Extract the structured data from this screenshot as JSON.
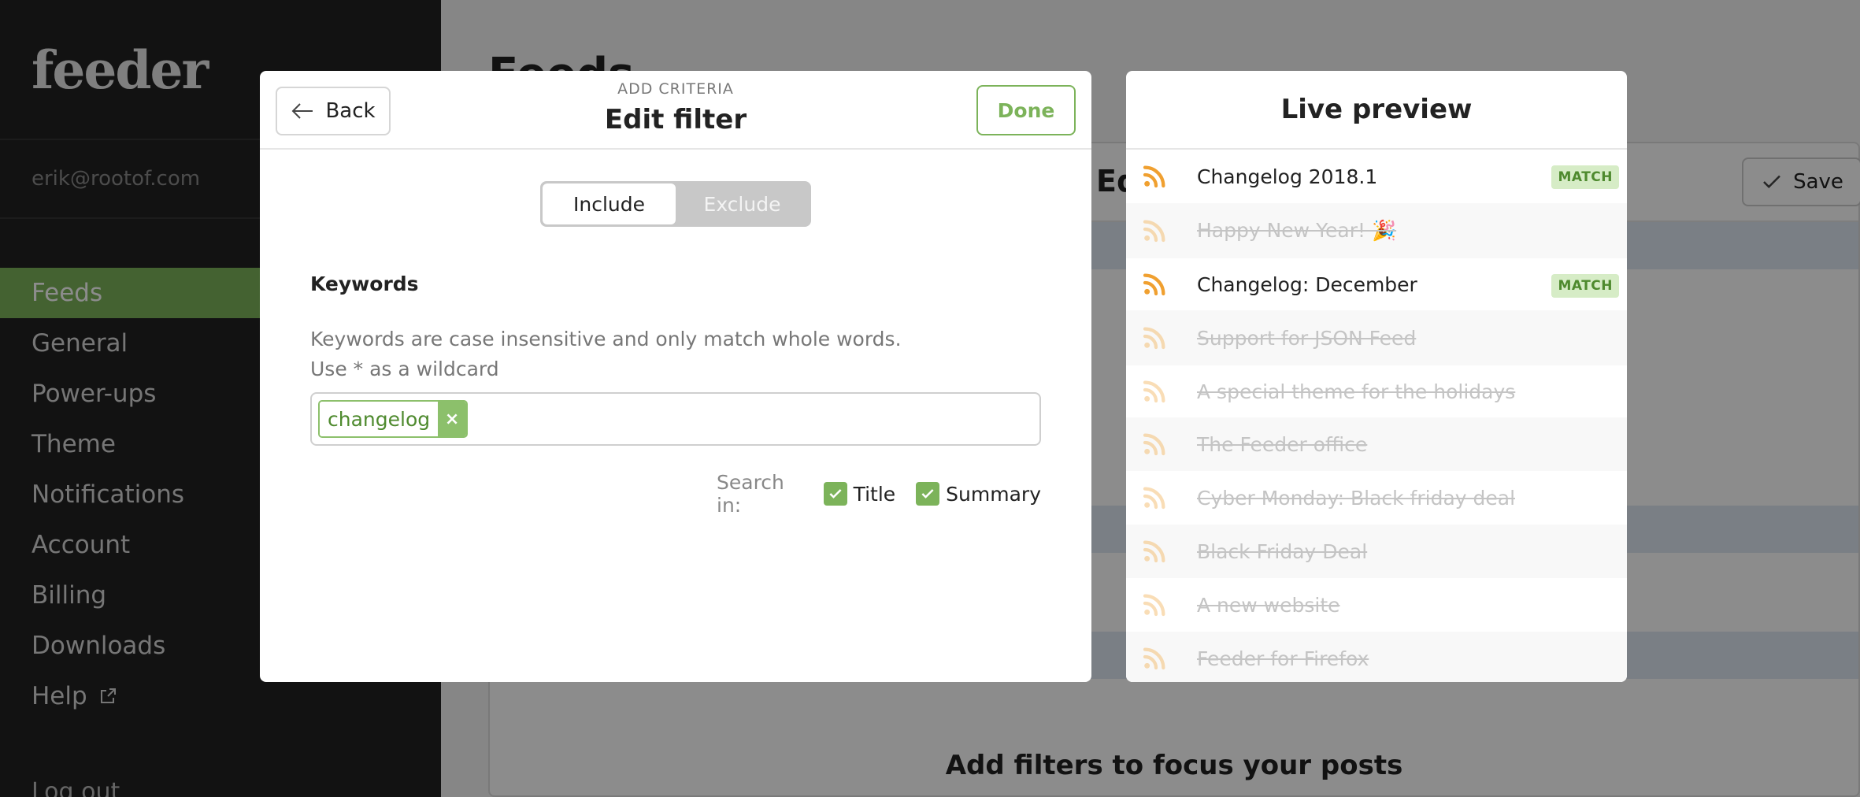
{
  "sidebar": {
    "logo": "feeder",
    "user_email": "erik@rootof.com",
    "items": [
      {
        "label": "Feeds",
        "active": true
      },
      {
        "label": "General"
      },
      {
        "label": "Power-ups"
      },
      {
        "label": "Theme"
      },
      {
        "label": "Notifications"
      },
      {
        "label": "Account"
      },
      {
        "label": "Billing"
      },
      {
        "label": "Downloads"
      },
      {
        "label": "Help",
        "icon": "external-link-icon"
      }
    ],
    "logout": "Log out"
  },
  "main": {
    "title": "Feeds",
    "panel_title": "Ed",
    "save_label": "Save",
    "empty_text": "Add filters to focus your posts"
  },
  "modal": {
    "kicker": "ADD CRITERIA",
    "title": "Edit filter",
    "back_label": "Back",
    "done_label": "Done",
    "segments": {
      "include": "Include",
      "exclude": "Exclude",
      "selected": "include"
    },
    "keywords_label": "Keywords",
    "help_line1": "Keywords are case insensitive and only match whole words.",
    "help_line2": "Use * as a wildcard",
    "tags": [
      "changelog"
    ],
    "tag_remove": "×",
    "search_in_label": "Search in:",
    "search_title": {
      "label": "Title",
      "checked": true
    },
    "search_summary": {
      "label": "Summary",
      "checked": true
    }
  },
  "preview": {
    "title": "Live preview",
    "match_label": "MATCH",
    "items": [
      {
        "title": "Changelog 2018.1",
        "match": true
      },
      {
        "title": "Happy New Year! 🎉",
        "match": false
      },
      {
        "title": "Changelog: December",
        "match": true
      },
      {
        "title": "Support for JSON Feed",
        "match": false
      },
      {
        "title": "A special theme for the holidays",
        "match": false
      },
      {
        "title": "The Feeder office",
        "match": false
      },
      {
        "title": "Cyber Monday: Black friday deal",
        "match": false
      },
      {
        "title": "Black Friday Deal",
        "match": false
      },
      {
        "title": "A new website",
        "match": false
      },
      {
        "title": "Feeder for Firefox",
        "match": false
      }
    ]
  },
  "colors": {
    "accent": "#7cb35a",
    "rss": "#f0a030",
    "sidebar_bg": "#222222"
  }
}
